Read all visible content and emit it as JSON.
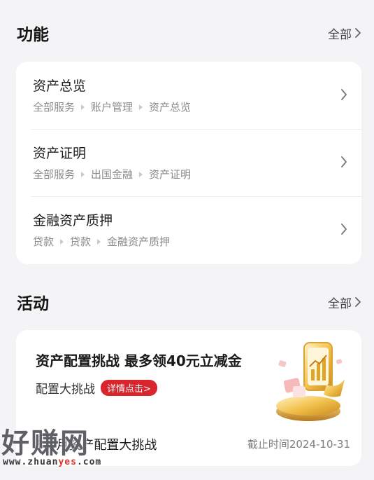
{
  "functions": {
    "title": "功能",
    "see_all": "全部",
    "items": [
      {
        "title": "资产总览",
        "path": [
          "全部服务",
          "账户管理",
          "资产总览"
        ]
      },
      {
        "title": "资产证明",
        "path": [
          "全部服务",
          "出国金融",
          "资产证明"
        ]
      },
      {
        "title": "金融资产质押",
        "path": [
          "贷款",
          "贷款",
          "金融资产质押"
        ]
      }
    ]
  },
  "activities": {
    "title": "活动",
    "see_all": "全部",
    "promo": {
      "headline": "资产配置挑战 最多领40元立减金",
      "subtitle": "配置大挑战",
      "detail_button": "详情点击>",
      "name": "6-9月资产配置大挑战",
      "deadline": "截止时间2024-10-31"
    }
  },
  "watermark": {
    "big": "好赚网",
    "url_prefix": "www.zhuan",
    "url_highlight": "yes",
    "url_suffix": ".com"
  },
  "colors": {
    "accent_red": "#d8262c",
    "background": "#f4f4f6",
    "card": "#ffffff"
  }
}
